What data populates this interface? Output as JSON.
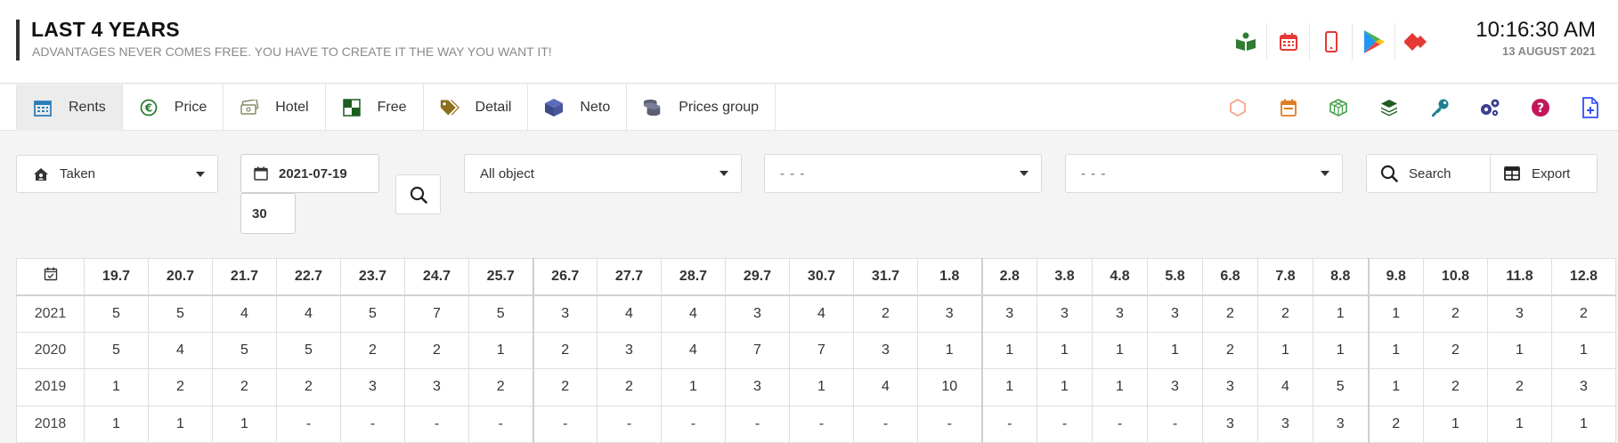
{
  "header": {
    "title": "LAST 4 YEARS",
    "subtitle": "ADVANTAGES NEVER COMES FREE. YOU HAVE TO CREATE IT THE WAY YOU WANT IT!",
    "icons": [
      "book-reader-icon",
      "calendar-icon",
      "mobile-icon",
      "play-store-icon",
      "anydesk-icon"
    ],
    "time": "10:16:30 AM",
    "date": "13 AUGUST 2021"
  },
  "tabs": [
    {
      "label": "Rents",
      "icon": "calendar-icon",
      "active": true
    },
    {
      "label": "Price",
      "icon": "euro-icon"
    },
    {
      "label": "Hotel",
      "icon": "money-bill-icon"
    },
    {
      "label": "Free",
      "icon": "checker-icon"
    },
    {
      "label": "Detail",
      "icon": "tags-icon"
    },
    {
      "label": "Neto",
      "icon": "cube-icon"
    },
    {
      "label": "Prices group",
      "icon": "coins-icon"
    }
  ],
  "nav_right_icons": [
    "hexagon-icon",
    "calendar-week-icon",
    "cubes-icon",
    "layer-group-icon",
    "key-icon",
    "cogs-icon",
    "question-circle-icon",
    "file-plus-icon"
  ],
  "filters": {
    "status": "Taken",
    "date": "2021-07-19",
    "days": "30",
    "object": "All object",
    "select2": "- - -",
    "select3": "- - -",
    "search_label": "Search",
    "export_label": "Export"
  },
  "table": {
    "columns": [
      "19.7",
      "20.7",
      "21.7",
      "22.7",
      "23.7",
      "24.7",
      "25.7",
      "26.7",
      "27.7",
      "28.7",
      "29.7",
      "30.7",
      "31.7",
      "1.8",
      "2.8",
      "3.8",
      "4.8",
      "5.8",
      "6.8",
      "7.8",
      "8.8",
      "9.8",
      "10.8",
      "11.8",
      "12.8"
    ],
    "rows": [
      {
        "year": "2021",
        "values": [
          "5",
          "5",
          "4",
          "4",
          "5",
          "7",
          "5",
          "3",
          "4",
          "4",
          "3",
          "4",
          "2",
          "3",
          "3",
          "3",
          "3",
          "3",
          "2",
          "2",
          "1",
          "1",
          "2",
          "3",
          "2"
        ]
      },
      {
        "year": "2020",
        "values": [
          "5",
          "4",
          "5",
          "5",
          "2",
          "2",
          "1",
          "2",
          "3",
          "4",
          "7",
          "7",
          "3",
          "1",
          "1",
          "1",
          "1",
          "1",
          "2",
          "1",
          "1",
          "1",
          "2",
          "1",
          "1"
        ]
      },
      {
        "year": "2019",
        "values": [
          "1",
          "2",
          "2",
          "2",
          "3",
          "3",
          "2",
          "2",
          "2",
          "1",
          "3",
          "1",
          "4",
          "10",
          "1",
          "1",
          "1",
          "3",
          "3",
          "4",
          "5",
          "1",
          "2",
          "2",
          "3"
        ]
      },
      {
        "year": "2018",
        "values": [
          "1",
          "1",
          "1",
          "-",
          "-",
          "-",
          "-",
          "-",
          "-",
          "-",
          "-",
          "-",
          "-",
          "-",
          "-",
          "-",
          "-",
          "-",
          "3",
          "3",
          "3",
          "2",
          "1",
          "1",
          "1"
        ]
      }
    ]
  }
}
